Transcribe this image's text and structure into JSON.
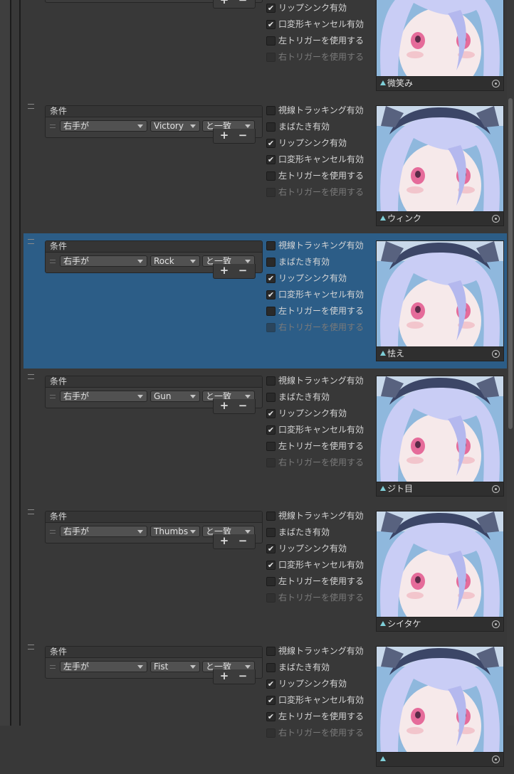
{
  "labels": {
    "condition_header": "条件",
    "plus": "+",
    "minus": "−",
    "check_eye": "視線トラッキング有効",
    "check_blink": "まばたき有効",
    "check_lipsync": "リップシンク有効",
    "check_mouth": "口変形キャンセル有効",
    "check_left_trigger": "左トリガーを使用する",
    "check_right_trigger": "右トリガーを使用する"
  },
  "entries": [
    {
      "hand": "右手が",
      "gesture": "",
      "match": "と一致",
      "checks": [
        false,
        false,
        true,
        true,
        false,
        false
      ],
      "preview": "微笑み",
      "selected": false
    },
    {
      "hand": "右手が",
      "gesture": "Victory",
      "match": "と一致",
      "checks": [
        false,
        false,
        true,
        true,
        false,
        false
      ],
      "preview": "ウィンク",
      "selected": false
    },
    {
      "hand": "右手が",
      "gesture": "Rock",
      "match": "と一致",
      "checks": [
        false,
        false,
        true,
        true,
        false,
        false
      ],
      "preview": "怯え",
      "selected": true
    },
    {
      "hand": "右手が",
      "gesture": "Gun",
      "match": "と一致",
      "checks": [
        false,
        false,
        true,
        true,
        false,
        false
      ],
      "preview": "ジト目",
      "selected": false
    },
    {
      "hand": "右手が",
      "gesture": "Thumbs",
      "match": "と一致",
      "checks": [
        false,
        false,
        true,
        true,
        false,
        false
      ],
      "preview": "シイタケ",
      "selected": false
    },
    {
      "hand": "左手が",
      "gesture": "Fist",
      "match": "と一致",
      "checks": [
        false,
        false,
        true,
        true,
        true,
        false
      ],
      "preview": "",
      "selected": false
    }
  ],
  "colors": {
    "panel_bg": "#383838",
    "selected_bg": "#2c5d87",
    "hair": "#c9cdf5",
    "eye_pink": "#e56b9a",
    "preview_sky": "#8fb8dd"
  },
  "icons": {
    "checkbox": "check-mark-icon",
    "caption": "cyan-triangle-icon",
    "target": "object-picker-icon"
  }
}
